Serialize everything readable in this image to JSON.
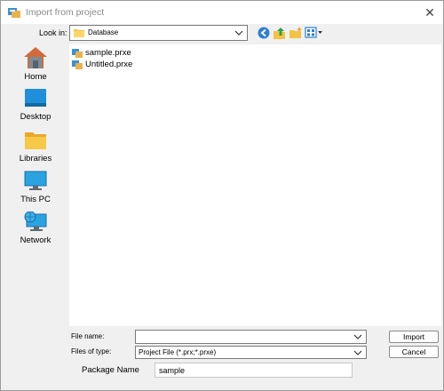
{
  "window": {
    "title": "Import from project",
    "close_glyph": "✕"
  },
  "look_in": {
    "label": "Look in:",
    "value": "Database",
    "icon": "folder-icon"
  },
  "toolbar": {
    "icons": [
      "back-icon",
      "up-folder-icon",
      "new-folder-icon",
      "view-menu-icon"
    ]
  },
  "sidebar": {
    "items": [
      {
        "label": "Home",
        "icon": "home-icon"
      },
      {
        "label": "Desktop",
        "icon": "desktop-icon"
      },
      {
        "label": "Libraries",
        "icon": "libraries-icon"
      },
      {
        "label": "This PC",
        "icon": "computer-icon"
      },
      {
        "label": "Network",
        "icon": "network-icon"
      }
    ]
  },
  "files": [
    {
      "name": "sample.prxe",
      "icon": "project-file-icon"
    },
    {
      "name": "Untitled.prxe",
      "icon": "project-file-icon"
    }
  ],
  "file_name": {
    "label": "File name:",
    "value": ""
  },
  "file_type": {
    "label": "Files of type:",
    "value": "Project File (*.prx;*.prxe)"
  },
  "buttons": {
    "import": "Import",
    "cancel": "Cancel"
  },
  "package": {
    "label": "Package Name",
    "value": "sample"
  },
  "colors": {
    "accent": "#1a73c8",
    "folder": "#f5c242",
    "window_bg": "#f0f0f0"
  }
}
